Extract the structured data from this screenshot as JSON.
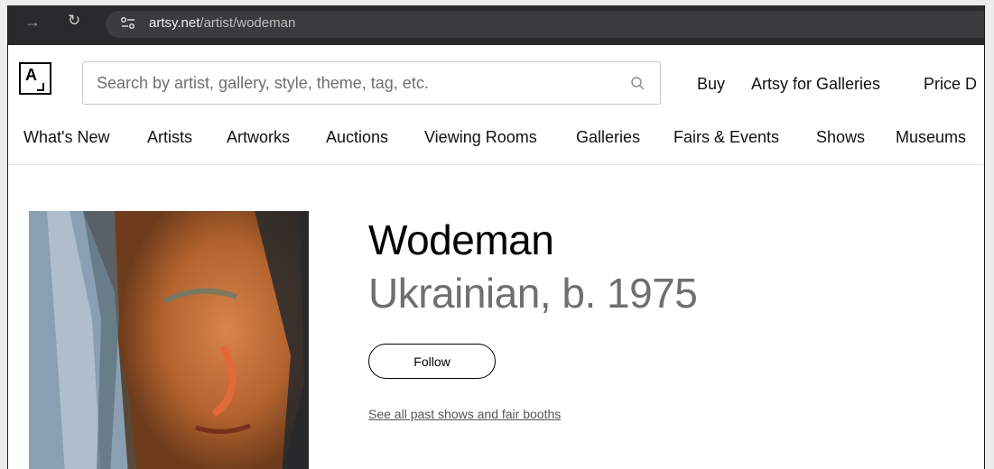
{
  "browser": {
    "url_domain": "artsy.net",
    "url_path": "/artist/wodeman",
    "back_icon": "arrow-right-icon",
    "reload_icon": "reload-icon"
  },
  "header": {
    "logo_text": "A",
    "search_placeholder": "Search by artist, gallery, style, theme, tag, etc.",
    "links": [
      "Buy",
      "Artsy for Galleries",
      "Price D"
    ]
  },
  "nav": {
    "items": [
      "What's New",
      "Artists",
      "Artworks",
      "Auctions",
      "Viewing Rooms",
      "Galleries",
      "Fairs & Events",
      "Shows",
      "Museums"
    ]
  },
  "artist": {
    "name": "Wodeman",
    "meta": "Ukrainian, b. 1975",
    "follow_label": "Follow",
    "past_shows_link": "See all past shows and fair booths"
  }
}
